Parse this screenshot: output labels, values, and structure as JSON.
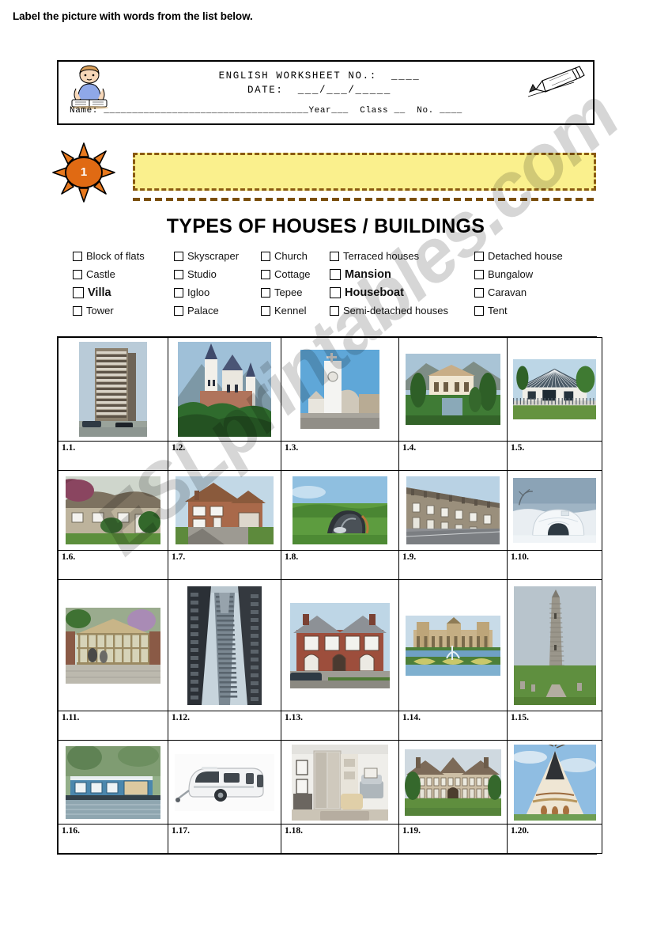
{
  "header": {
    "line1": "ENGLISH WORKSHEET NO.:  ____",
    "line2": "DATE:  ___/___/_____",
    "name_line": "Name: ____________________________________Year___  Class __  No. ____",
    "kid_icon": "child-reading-icon",
    "pencil_icon": "pencil-icon"
  },
  "task": {
    "number": "1",
    "badge_icon": "sun-burst-icon",
    "instruction": "Label the picture with words from the list below."
  },
  "title": "TYPES OF HOUSES / BUILDINGS",
  "word_list": {
    "columns": 5,
    "rows": [
      [
        {
          "label": "Block of flats",
          "bold": false
        },
        {
          "label": "Skyscraper",
          "bold": false
        },
        {
          "label": "Church",
          "bold": false
        },
        {
          "label": "Terraced houses",
          "bold": false
        },
        {
          "label": "Detached house",
          "bold": false
        }
      ],
      [
        {
          "label": "Castle",
          "bold": false
        },
        {
          "label": "Studio",
          "bold": false
        },
        {
          "label": "Cottage",
          "bold": false
        },
        {
          "label": "Mansion",
          "bold": true
        },
        {
          "label": "Bungalow",
          "bold": false
        }
      ],
      [
        {
          "label": "Villa",
          "bold": true
        },
        {
          "label": "Igloo",
          "bold": false
        },
        {
          "label": "Tepee",
          "bold": false
        },
        {
          "label": "Houseboat",
          "bold": true
        },
        {
          "label": "Caravan",
          "bold": false
        }
      ],
      [
        {
          "label": "Tower",
          "bold": false
        },
        {
          "label": "Palace",
          "bold": false
        },
        {
          "label": "Kennel",
          "bold": false
        },
        {
          "label": "Semi-detached houses",
          "bold": false
        },
        {
          "label": "Tent",
          "bold": false
        }
      ]
    ]
  },
  "grid": {
    "rows": 4,
    "cols": 5,
    "cells": [
      {
        "number": "1.1.",
        "image": "high-rise-apartment-block-photo",
        "answer": ""
      },
      {
        "number": "1.2.",
        "image": "fairytale-castle-photo",
        "answer": ""
      },
      {
        "number": "1.3.",
        "image": "modern-church-tower-photo",
        "answer": ""
      },
      {
        "number": "1.4.",
        "image": "mansion-with-gardens-photo",
        "answer": ""
      },
      {
        "number": "1.5.",
        "image": "single-storey-bungalow-photo",
        "answer": ""
      },
      {
        "number": "1.6.",
        "image": "thatched-stone-cottage-photo",
        "answer": ""
      },
      {
        "number": "1.7.",
        "image": "brick-detached-house-photo",
        "answer": ""
      },
      {
        "number": "1.8.",
        "image": "camping-tent-on-grass-photo",
        "answer": ""
      },
      {
        "number": "1.9.",
        "image": "terraced-houses-street-photo",
        "answer": ""
      },
      {
        "number": "1.10.",
        "image": "snow-igloo-photo",
        "answer": ""
      },
      {
        "number": "1.11.",
        "image": "dog-kennel-run-photo",
        "answer": ""
      },
      {
        "number": "1.12.",
        "image": "skyscraper-looking-up-photo",
        "answer": ""
      },
      {
        "number": "1.13.",
        "image": "red-brick-semi-detached-photo",
        "answer": ""
      },
      {
        "number": "1.14.",
        "image": "palace-with-formal-garden-photo",
        "answer": ""
      },
      {
        "number": "1.15.",
        "image": "round-stone-tower-photo",
        "answer": ""
      },
      {
        "number": "1.16.",
        "image": "blue-houseboat-on-river-photo",
        "answer": ""
      },
      {
        "number": "1.17.",
        "image": "white-touring-caravan-photo",
        "answer": ""
      },
      {
        "number": "1.18.",
        "image": "studio-apartment-interior-photo",
        "answer": ""
      },
      {
        "number": "1.19.",
        "image": "large-tudor-manor-villa-photo",
        "answer": ""
      },
      {
        "number": "1.20.",
        "image": "native-american-tepee-photo",
        "answer": ""
      }
    ]
  },
  "watermark": {
    "text": "ESLprintables.com"
  },
  "colors": {
    "task_box_background": "#faf08d",
    "task_box_border": "#8a5a11",
    "sun_badge": "#e8791e",
    "sun_badge_center": "#e06a13",
    "page_background": "#ffffff",
    "ink": "#000000"
  }
}
